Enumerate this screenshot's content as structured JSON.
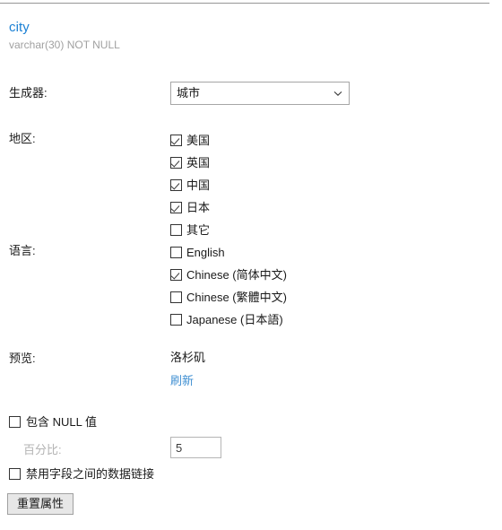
{
  "field": {
    "name": "city",
    "type_info": "varchar(30) NOT NULL"
  },
  "generator": {
    "label": "生成器:",
    "selected": "城市",
    "chevron_icon": "chevron-down-icon"
  },
  "region": {
    "label": "地区:",
    "items": [
      {
        "label": "美国",
        "checked": true
      },
      {
        "label": "英国",
        "checked": true
      },
      {
        "label": "中国",
        "checked": true
      },
      {
        "label": "日本",
        "checked": true
      },
      {
        "label": "其它",
        "checked": false
      }
    ]
  },
  "language": {
    "label": "语言:",
    "items": [
      {
        "label": "English",
        "checked": false
      },
      {
        "label": "Chinese (简体中文)",
        "checked": true
      },
      {
        "label": "Chinese (繁體中文)",
        "checked": false
      },
      {
        "label": "Japanese (日本語)",
        "checked": false
      }
    ]
  },
  "preview": {
    "label": "预览:",
    "value": "洛杉矶",
    "refresh_label": "刷新"
  },
  "options": {
    "include_null_label": "包含 NULL 值",
    "include_null_checked": false,
    "percent_label": "百分比:",
    "percent_value": "5",
    "percent_disabled": true,
    "disable_chain_label": "禁用字段之间的数据链接",
    "disable_chain_checked": false
  },
  "actions": {
    "reset_label": "重置属性"
  },
  "colors": {
    "field_name": "#1b80d4",
    "link": "#3f8fd2",
    "muted": "#a0a0a0",
    "text": "#1a1a1a",
    "border": "#a6a6a6",
    "button_face": "#e7e7e7"
  }
}
